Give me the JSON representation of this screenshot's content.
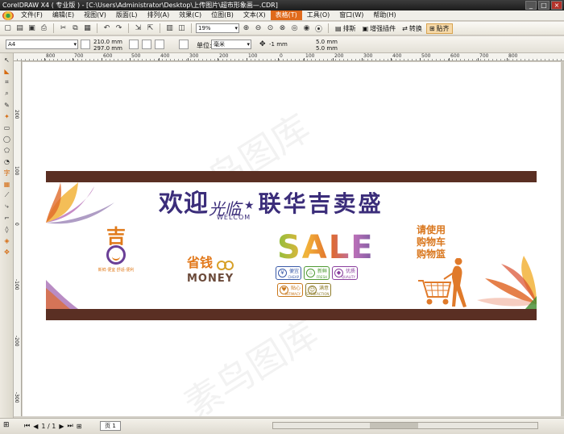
{
  "window": {
    "title": "CorelDRAW X4 ( 专业版 ) - [C:\\Users\\Administrator\\Desktop\\上传图片\\超市形象画—.CDR]",
    "controls": [
      "_",
      "□",
      "×"
    ]
  },
  "menu": {
    "items": [
      "文件(F)",
      "编辑(E)",
      "视图(V)",
      "版面(L)",
      "排列(A)",
      "效果(C)",
      "位图(B)",
      "文本(X)",
      "表格(T)",
      "工具(O)",
      "窗口(W)",
      "帮助(H)"
    ],
    "active_index": 8
  },
  "toolbar": {
    "zoom": "19%",
    "snap_label": "贴齐",
    "arrange_label": "排斯",
    "plugin_label": "增强插件",
    "convert_label": "转换",
    "snap_to_label": "贴齐"
  },
  "propbar": {
    "paper": "A4",
    "width": "210.0 mm",
    "height": "297.0 mm",
    "unit_label": "单位:",
    "unit": "毫米",
    "nudge": "-1 mm",
    "dup_x": "5.0 mm",
    "dup_y": "5.0 mm"
  },
  "ruler": {
    "top_labels": [
      "800",
      "700",
      "600",
      "500",
      "400",
      "300",
      "200",
      "100",
      "0",
      "100",
      "200",
      "300",
      "400",
      "500",
      "600",
      "700",
      "800"
    ],
    "left_labels": [
      "200",
      "100",
      "0",
      "-100",
      "-200",
      "-300"
    ]
  },
  "banner": {
    "headline_big": "欢迎",
    "headline_script": "光临",
    "headline_sub": "WELCOM",
    "store_name": "联华吉卖盛",
    "logo_char": "吉",
    "logo_tagline": "新鲜·便宜·舒适·便利",
    "money_cn": "省钱",
    "money_en": "MONEY",
    "sale": "SALE",
    "badges": [
      {
        "label": "便宜",
        "sub": "CHEAP",
        "icon": "¥"
      },
      {
        "label": "新鲜",
        "sub": "FRESH",
        "icon": "♨"
      },
      {
        "label": "优质",
        "sub": "QUALITY",
        "icon": "◆"
      },
      {
        "label": "贴心",
        "sub": "INTIMACY",
        "icon": "♥"
      },
      {
        "label": "满意",
        "sub": "SATISFACTION",
        "icon": "☺"
      }
    ],
    "invite_lines": [
      "请使用",
      "购物车",
      "购物篮"
    ],
    "colors": {
      "band": "#5a2f23",
      "headline": "#3b2d7a",
      "accent": "#e2791b"
    }
  },
  "watermark": "素鸟图库",
  "status": {
    "page_counter": "1 / 1",
    "page_tab": "页 1"
  }
}
